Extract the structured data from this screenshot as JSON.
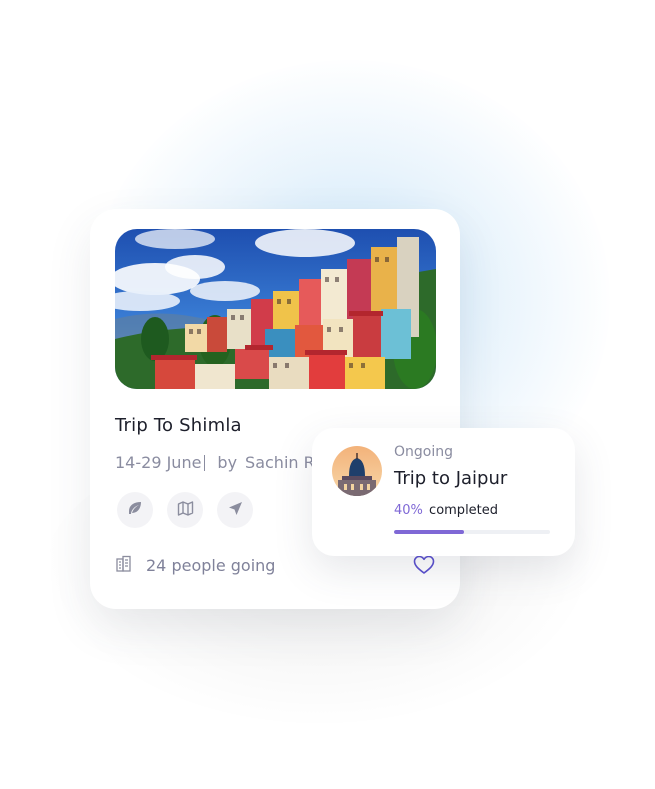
{
  "trip_card": {
    "title": "Trip To Shimla",
    "dates": "14-29 June",
    "by_label": "by",
    "author": "Sachin Rathore",
    "image": "shimla-hillside-photo",
    "actions": [
      "leaf-icon",
      "map-icon",
      "send-icon"
    ],
    "people_going": "24 people going",
    "favorite_icon": "heart-icon"
  },
  "progress_card": {
    "status": "Ongoing",
    "title": "Trip to Jaipur",
    "percent_label": "40%",
    "completed_label": "completed",
    "progress": 0.45,
    "accent": "#7f68d6"
  }
}
